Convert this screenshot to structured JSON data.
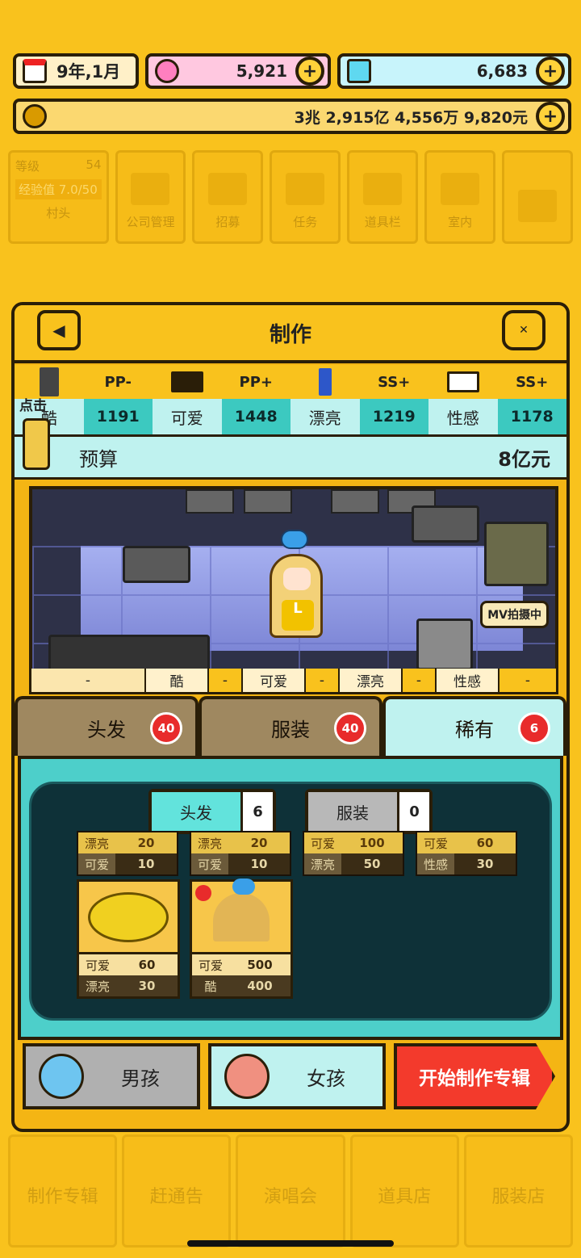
{
  "status": {
    "date": "9年,1月",
    "pink_currency": "5,921",
    "blue_currency": "6,683",
    "money": "3兆 2,915亿 4,556万 9,820元"
  },
  "background_menu": {
    "level_label": "等级",
    "level_value": "54",
    "exp": "经验值 7.0/50",
    "location": "村头",
    "items": [
      "公司管理",
      "招募",
      "任务",
      "道具栏",
      "室内"
    ],
    "bottom_items": [
      "制作专辑",
      "赶通告",
      "演唱会",
      "道具店",
      "服装店"
    ]
  },
  "panel": {
    "title": "制作",
    "back_icon": "back-arrow-icon",
    "close_icon": "close-icon"
  },
  "stats": [
    {
      "grade": "PP-",
      "label": "酷",
      "value": "1191",
      "icon": "robot-icon"
    },
    {
      "grade": "PP+",
      "label": "可爱",
      "value": "1448",
      "icon": "piano-icon"
    },
    {
      "grade": "SS+",
      "label": "漂亮",
      "value": "1219",
      "icon": "microphone-icon"
    },
    {
      "grade": "SS+",
      "label": "性感",
      "value": "1178",
      "icon": "keyboard-icon"
    }
  ],
  "tap_hint": "点击",
  "budget": {
    "label": "预算",
    "value": "8亿元"
  },
  "stage": {
    "badge": "MV拍摄中",
    "shirt_letter": "L",
    "attributes": [
      "-",
      "酷",
      "-",
      "可爱",
      "-",
      "漂亮",
      "-",
      "性感",
      "-"
    ]
  },
  "tabs": [
    {
      "label": "头发",
      "count": "40"
    },
    {
      "label": "服装",
      "count": "40"
    },
    {
      "label": "稀有",
      "count": "6"
    }
  ],
  "subtabs": [
    {
      "label": "头发",
      "count": "6"
    },
    {
      "label": "服装",
      "count": "0"
    }
  ],
  "strip_items": [
    {
      "r1k": "漂亮",
      "r1v": "20",
      "r2k": "可爱",
      "r2v": "10"
    },
    {
      "r1k": "漂亮",
      "r1v": "20",
      "r2k": "可爱",
      "r2v": "10"
    },
    {
      "r1k": "可爱",
      "r1v": "100",
      "r2k": "漂亮",
      "r2v": "50"
    },
    {
      "r1k": "可爱",
      "r1v": "60",
      "r2k": "性感",
      "r2v": "30"
    }
  ],
  "cards": [
    {
      "k1": "可爱",
      "v1": "60",
      "k2": "漂亮",
      "v2": "30"
    },
    {
      "k1": "可爱",
      "v1": "500",
      "k2": "酷",
      "v2": "400"
    }
  ],
  "bottom": {
    "boy": "男孩",
    "girl": "女孩",
    "start": "开始制作专辑"
  }
}
